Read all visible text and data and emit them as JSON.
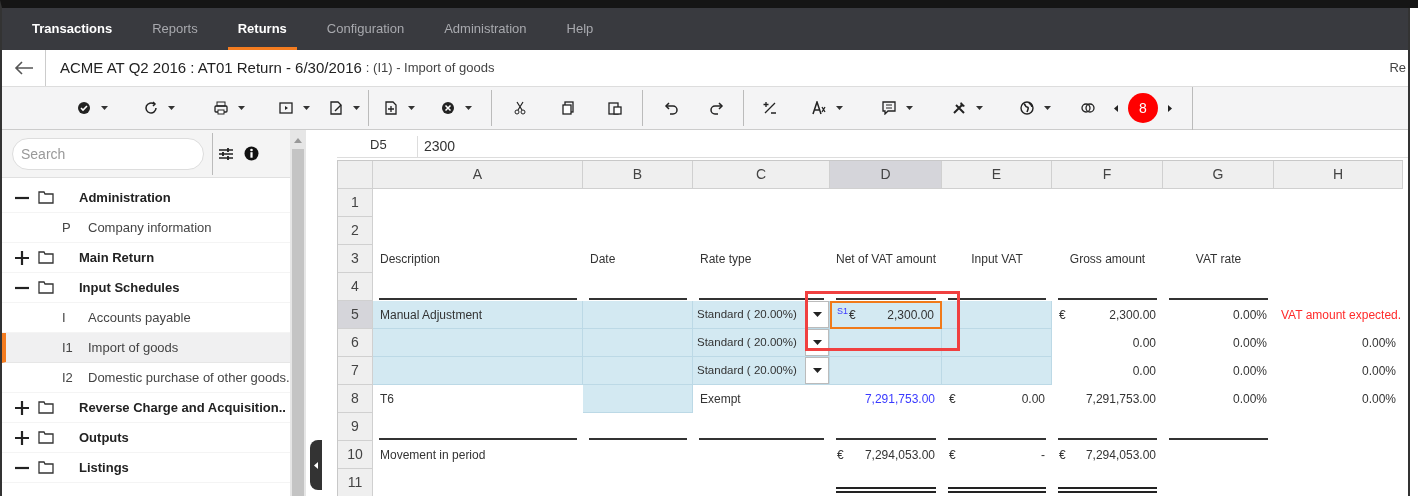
{
  "nav": {
    "tabs": [
      {
        "label": "Transactions",
        "selected": false
      },
      {
        "label": "Reports",
        "selected": false
      },
      {
        "label": "Returns",
        "selected": true
      },
      {
        "label": "Configuration",
        "selected": false
      },
      {
        "label": "Administration",
        "selected": false
      },
      {
        "label": "Help",
        "selected": false
      }
    ]
  },
  "breadcrumb": {
    "title": "ACME AT Q2 2016 : AT01 Return - 6/30/2016",
    "subtitle": ": (I1) - Import of goods",
    "right_text": "Re"
  },
  "toolbar": {
    "badge": "8"
  },
  "sidebar": {
    "search": {
      "placeholder": "Search"
    },
    "tree": [
      {
        "label": "Administration",
        "expanded": true,
        "children": [
          {
            "code": "P",
            "label": "Company information",
            "selected": false
          }
        ]
      },
      {
        "label": "Main Return",
        "expanded": false
      },
      {
        "label": "Input Schedules",
        "expanded": true,
        "children": [
          {
            "code": "I",
            "label": "Accounts payable",
            "selected": false
          },
          {
            "code": "I1",
            "label": "Import of goods",
            "selected": true
          },
          {
            "code": "I2",
            "label": "Domestic purchase of other goods.",
            "selected": false
          }
        ]
      },
      {
        "label": "Reverse Charge and Acquisition..",
        "expanded": false
      },
      {
        "label": "Outputs",
        "expanded": false
      },
      {
        "label": "Listings",
        "expanded": true
      }
    ]
  },
  "sheet": {
    "cell_ref": "D5",
    "formula": "2300",
    "columns": [
      {
        "label": "A",
        "selected": false
      },
      {
        "label": "B",
        "selected": false
      },
      {
        "label": "C",
        "selected": false
      },
      {
        "label": "D",
        "selected": true
      },
      {
        "label": "E",
        "selected": false
      },
      {
        "label": "F",
        "selected": false
      },
      {
        "label": "G",
        "selected": false
      },
      {
        "label": "H",
        "selected": false
      }
    ],
    "rows": [
      {
        "number": "1",
        "selected": false,
        "cells": [
          null,
          null,
          null,
          null,
          null,
          null,
          null,
          null
        ]
      },
      {
        "number": "2",
        "selected": false,
        "cells": [
          null,
          null,
          null,
          null,
          null,
          null,
          null,
          null
        ]
      },
      {
        "number": "3",
        "selected": false,
        "cells": [
          {
            "kind": "heading",
            "text": "Description"
          },
          {
            "kind": "heading",
            "text": "Date"
          },
          {
            "kind": "heading",
            "text": "Rate type"
          },
          {
            "kind": "heading",
            "text": "Net of VAT amount"
          },
          {
            "kind": "heading",
            "text": "Input VAT"
          },
          {
            "kind": "heading",
            "text": "Gross amount"
          },
          {
            "kind": "heading",
            "text": "VAT rate"
          },
          null
        ]
      },
      {
        "number": "4",
        "selected": false,
        "cells": [
          {
            "underline": true
          },
          {
            "underline": true
          },
          {
            "underline": true
          },
          {
            "underline": true
          },
          {
            "underline": true
          },
          {
            "underline": true
          },
          {
            "underline": true
          },
          null
        ]
      },
      {
        "number": "5",
        "selected": true,
        "cells": [
          {
            "kind": "text",
            "text": "Manual Adjustment",
            "shaded": true
          },
          {
            "shaded": true
          },
          {
            "kind": "text",
            "text": "Standard ( 20.00%)",
            "shaded": true,
            "dropdown": true
          },
          {
            "kind": "amount",
            "tag": "S1",
            "currency": "€",
            "text": "2,300.00",
            "shaded": true,
            "active": true
          },
          {
            "shaded": true
          },
          {
            "kind": "amount",
            "currency": "€",
            "text": "2,300.00"
          },
          {
            "kind": "amount",
            "text": "0.00%"
          },
          {
            "kind": "text",
            "text": "VAT amount expected.",
            "error": true
          }
        ]
      },
      {
        "number": "6",
        "selected": false,
        "cells": [
          {
            "shaded": true
          },
          {
            "shaded": true
          },
          {
            "kind": "text",
            "text": "Standard ( 20.00%)",
            "shaded": true,
            "dropdown": true
          },
          {
            "shaded": true
          },
          {
            "shaded": true
          },
          {
            "kind": "amount",
            "text": "0.00"
          },
          {
            "kind": "amount",
            "text": "0.00%"
          },
          {
            "kind": "amount",
            "text": "0.00%"
          }
        ]
      },
      {
        "number": "7",
        "selected": false,
        "cells": [
          {
            "shaded": true
          },
          {
            "shaded": true
          },
          {
            "kind": "text",
            "text": "Standard ( 20.00%)",
            "shaded": true,
            "dropdown": true
          },
          {
            "shaded": true
          },
          {
            "shaded": true
          },
          {
            "kind": "amount",
            "text": "0.00"
          },
          {
            "kind": "amount",
            "text": "0.00%"
          },
          {
            "kind": "amount",
            "text": "0.00%"
          }
        ]
      },
      {
        "number": "8",
        "selected": false,
        "cells": [
          {
            "kind": "text",
            "text": "T6"
          },
          {
            "shaded": true
          },
          {
            "kind": "text",
            "text": "Exempt"
          },
          {
            "kind": "amount",
            "text": "7,291,753.00",
            "link": true
          },
          {
            "kind": "amount",
            "currency": "€",
            "text": "0.00"
          },
          {
            "kind": "amount",
            "text": "7,291,753.00"
          },
          {
            "kind": "amount",
            "text": "0.00%"
          },
          {
            "kind": "amount",
            "text": "0.00%"
          }
        ]
      },
      {
        "number": "9",
        "selected": false,
        "cells": [
          {
            "underline": true
          },
          {
            "underline": true
          },
          {
            "underline": true
          },
          {
            "underline": true
          },
          {
            "underline": true
          },
          {
            "underline": true
          },
          {
            "underline": true
          },
          null
        ]
      },
      {
        "number": "10",
        "selected": false,
        "cells": [
          {
            "kind": "text",
            "text": "Movement in period"
          },
          null,
          null,
          {
            "kind": "amount",
            "currency": "€",
            "text": "7,294,053.00"
          },
          {
            "kind": "amount",
            "currency": "€",
            "text": "-"
          },
          {
            "kind": "amount",
            "currency": "€",
            "text": "7,294,053.00"
          },
          null,
          null
        ]
      },
      {
        "number": "11",
        "selected": false,
        "cells": [
          null,
          null,
          null,
          {
            "double_underline": true
          },
          {
            "double_underline": true
          },
          {
            "double_underline": true
          },
          null,
          null
        ]
      }
    ]
  }
}
